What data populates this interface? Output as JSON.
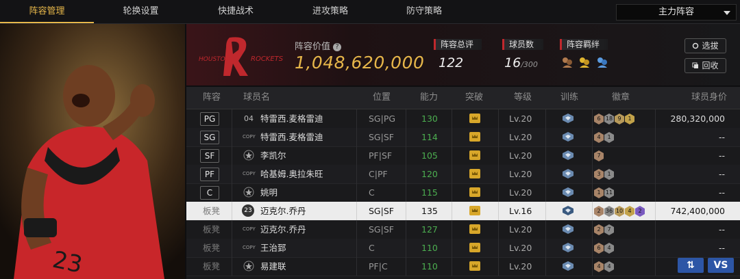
{
  "nav": {
    "tabs": [
      {
        "label": "阵容管理",
        "active": true
      },
      {
        "label": "轮换设置",
        "active": false
      },
      {
        "label": "快捷战术",
        "active": false
      },
      {
        "label": "进攻策略",
        "active": false
      },
      {
        "label": "防守策略",
        "active": false
      }
    ],
    "lineup_select": "主力阵容"
  },
  "team": {
    "logo_text": "HOUSTON ROCKETS",
    "value_label": "阵容价值",
    "value": "1,048,620,000"
  },
  "stats": {
    "overall_label": "阵容总评",
    "overall_value": "122",
    "players_label": "球员数",
    "players_value": "16",
    "players_max": "/300",
    "bonds_label": "阵容羁绊"
  },
  "buttons": {
    "select": "选拔",
    "recycle": "回收",
    "swap": "⇅",
    "vs": "VS"
  },
  "columns": [
    "阵容",
    "球员名",
    "位置",
    "能力",
    "突破",
    "等级",
    "训练",
    "徽章",
    "球员身价"
  ],
  "rows": [
    {
      "slot": "PG",
      "tag": "04",
      "name": "特雷西.麦格雷迪",
      "pos": "SG|PG",
      "ability": "130",
      "level": "Lv.20",
      "badges": [
        "6",
        "18",
        "9",
        "1"
      ],
      "value": "280,320,000",
      "bench": false,
      "selected": false
    },
    {
      "slot": "SG",
      "tag": "COPY",
      "name": "特雷西.麦格雷迪",
      "pos": "SG|SF",
      "ability": "114",
      "level": "Lv.20",
      "badges": [
        "4",
        "1"
      ],
      "value": "--",
      "bench": false,
      "selected": false
    },
    {
      "slot": "SF",
      "tag": "star",
      "name": "李凯尔",
      "pos": "PF|SF",
      "ability": "105",
      "level": "Lv.20",
      "badges": [
        "7"
      ],
      "value": "--",
      "bench": false,
      "selected": false
    },
    {
      "slot": "PF",
      "tag": "COPY",
      "name": "哈基姆.奥拉朱旺",
      "pos": "C|PF",
      "ability": "120",
      "level": "Lv.20",
      "badges": [
        "3",
        "1"
      ],
      "value": "--",
      "bench": false,
      "selected": false
    },
    {
      "slot": "C",
      "tag": "star",
      "name": "姚明",
      "pos": "C",
      "ability": "115",
      "level": "Lv.20",
      "badges": [
        "1",
        "11"
      ],
      "value": "--",
      "bench": false,
      "selected": false
    },
    {
      "slot": "板凳",
      "tag": "23",
      "name": "迈克尔.乔丹",
      "pos": "SG|SF",
      "ability": "135",
      "level": "Lv.16",
      "badges": [
        "2",
        "36",
        "10",
        "4",
        "2"
      ],
      "value": "742,400,000",
      "bench": true,
      "selected": true
    },
    {
      "slot": "板凳",
      "tag": "COPY",
      "name": "迈克尔.乔丹",
      "pos": "SG|SF",
      "ability": "127",
      "level": "Lv.20",
      "badges": [
        "2",
        "7"
      ],
      "value": "--",
      "bench": true,
      "selected": false
    },
    {
      "slot": "板凳",
      "tag": "COPY",
      "name": "王治郅",
      "pos": "C",
      "ability": "110",
      "level": "Lv.20",
      "badges": [
        "6",
        "4"
      ],
      "value": "--",
      "bench": true,
      "selected": false
    },
    {
      "slot": "板凳",
      "tag": "star",
      "name": "易建联",
      "pos": "PF|C",
      "ability": "110",
      "level": "Lv.20",
      "badges": [
        "4",
        "4"
      ],
      "value": "--",
      "bench": true,
      "selected": false
    }
  ],
  "colors": {
    "accent": "#e8b84a",
    "ability_green": "#4caf50",
    "action_blue": "#2d56a6",
    "team_red": "#c0282d"
  }
}
